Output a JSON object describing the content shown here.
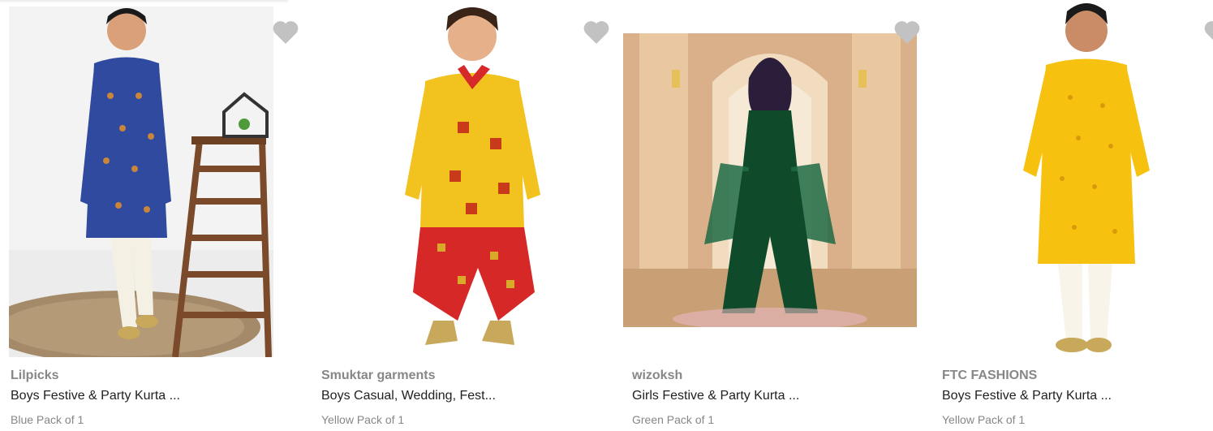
{
  "products": [
    {
      "brand": "Lilpicks",
      "title": "Boys Festive & Party Kurta ...",
      "variant": "Blue Pack of 1",
      "image_icon": "boy-blue-kurta-image",
      "outfit_color": "#2f4a9e"
    },
    {
      "brand": "Smuktar garments",
      "title": "Boys Casual, Wedding, Fest...",
      "variant": "Yellow Pack of 1",
      "image_icon": "boy-yellow-red-dhoti-image",
      "outfit_color": "#f2c21e"
    },
    {
      "brand": "wizoksh",
      "title": "Girls Festive & Party Kurta ...",
      "variant": "Green Pack of 1",
      "image_icon": "girl-green-outfit-image",
      "outfit_color": "#0f4a2a"
    },
    {
      "brand": "FTC FASHIONS",
      "title": "Boys Festive & Party Kurta ...",
      "variant": "Yellow Pack of 1",
      "image_icon": "boy-yellow-kurta-image",
      "outfit_color": "#f7c20f"
    }
  ],
  "colors": {
    "wishlist_heart": "#c2c2c2",
    "brand_text": "#878787",
    "title_text": "#212121"
  }
}
